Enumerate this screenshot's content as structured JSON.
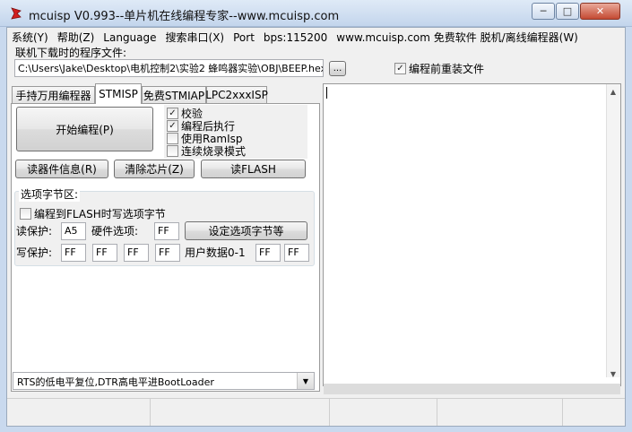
{
  "window": {
    "title": "mcuisp V0.993--单片机在线编程专家--www.mcuisp.com",
    "minimize": "─",
    "maximize": "□",
    "close": "✕"
  },
  "menu": [
    "系统(Y)",
    "帮助(Z)",
    "Language",
    "搜索串口(X)",
    "Port",
    "bps:115200",
    "www.mcuisp.com 免费软件 脱机/离线编程器(W)"
  ],
  "file": {
    "label": "联机下载时的程序文件:",
    "path": "C:\\Users\\Jake\\Desktop\\电机控制2\\实验2 蜂鸣器实验\\OBJ\\BEEP.hex",
    "browse": "...",
    "reload_label": "编程前重装文件",
    "reload_checked": true
  },
  "tabs": [
    "手持万用编程器",
    "STMISP",
    "免费STMIAP",
    "LPC2xxxISP"
  ],
  "active_tab": "STMISP",
  "stmisp": {
    "start_button": "开始编程(P)",
    "options": [
      {
        "label": "校验",
        "checked": true
      },
      {
        "label": "编程后执行",
        "checked": true
      },
      {
        "label": "使用RamIsp",
        "checked": false
      },
      {
        "label": "连续烧录模式",
        "checked": false
      }
    ],
    "read_device_info": "读器件信息(R)",
    "erase_chip": "清除芯片(Z)",
    "read_flash": "读FLASH",
    "option_bytes_title": "选项字节区:",
    "write_option_label": "编程到FLASH时写选项字节",
    "read_protect_label": "读保护:",
    "read_protect_value": "A5",
    "hw_option_label": "硬件选项:",
    "hw_option_value": "FF",
    "set_option_button": "设定选项字节等",
    "write_protect_label": "写保护:",
    "write_protect_values": [
      "FF",
      "FF",
      "FF",
      "FF"
    ],
    "user_data_label": "用户数据0-1",
    "user_data_values": [
      "FF",
      "FF"
    ]
  },
  "bootloader_mode": "RTS的低电平复位,DTR高电平进BootLoader"
}
